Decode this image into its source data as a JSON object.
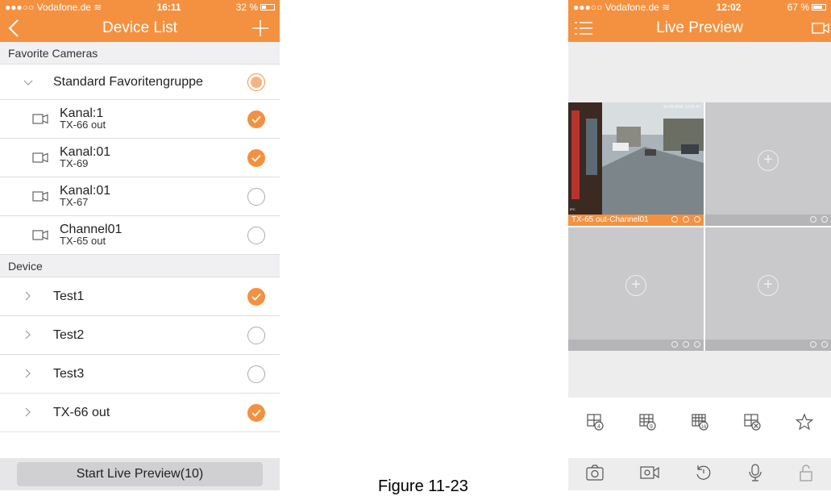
{
  "colors": {
    "accent": "#f39140"
  },
  "left": {
    "status": {
      "carrier": "●●●○○ Vodafone.de ≋",
      "time": "16:11",
      "battery": "32 %"
    },
    "nav": {
      "title": "Device List",
      "back_icon": "chevron-left-icon",
      "add_icon": "plus-icon"
    },
    "sections": {
      "favorites": "Favorite Cameras",
      "device": "Device"
    },
    "group": {
      "label": "Standard Favoritengruppe",
      "state": "partial"
    },
    "channels": [
      {
        "name": "Kanal:1",
        "sub": "TX-66 out",
        "checked": true
      },
      {
        "name": "Kanal:01",
        "sub": "TX-69",
        "checked": true
      },
      {
        "name": "Kanal:01",
        "sub": "TX-67",
        "checked": false
      },
      {
        "name": "Channel01",
        "sub": "TX-65 out",
        "checked": false
      }
    ],
    "devices": [
      {
        "name": "Test1",
        "checked": true
      },
      {
        "name": "Test2",
        "checked": false
      },
      {
        "name": "Test3",
        "checked": false
      },
      {
        "name": "TX-66 out",
        "checked": true
      }
    ],
    "start_button": "Start Live Preview(10)"
  },
  "caption": "Figure 11-23",
  "right": {
    "status": {
      "carrier": "●●●○○ Vodafone.de ≋",
      "time": "12:02",
      "battery": "67 %"
    },
    "nav": {
      "title": "Live Preview",
      "menu_icon": "menu-icon",
      "camera_icon": "video-camera-icon"
    },
    "video": {
      "channel_label": "TX-65 out-Channel01",
      "overlay_date": "10-05-2016 12:01:47",
      "overlay_ipc": "IPC"
    },
    "layout_tools": [
      "grid-4-icon",
      "grid-9-icon",
      "grid-16-icon",
      "grid-close-icon",
      "star-icon"
    ],
    "bottom_tools": [
      "snapshot-icon",
      "record-icon",
      "playback-icon",
      "microphone-icon",
      "lock-icon"
    ]
  }
}
